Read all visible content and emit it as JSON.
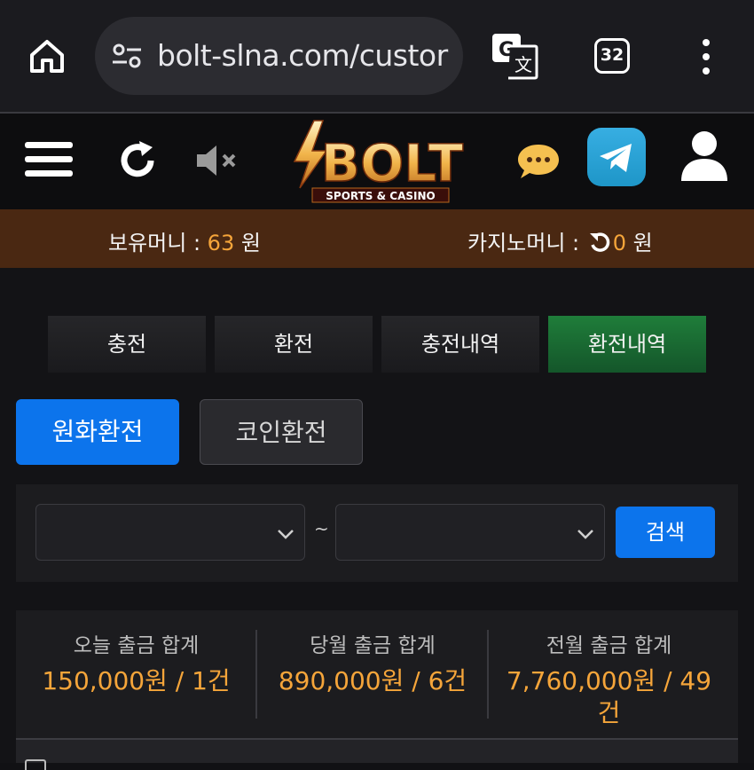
{
  "browser": {
    "url": "bolt-slna.com/custor",
    "tab_count": "32",
    "icons": [
      "home-icon",
      "site-settings-icon",
      "translate-icon",
      "tabs-icon",
      "more-icon"
    ]
  },
  "header": {
    "logo_main": "BOLT",
    "logo_sub": "SPORTS & CASINO",
    "icons": [
      "menu-icon",
      "refresh-icon",
      "mute-icon",
      "chat-icon",
      "telegram-icon",
      "user-icon"
    ]
  },
  "balance": {
    "holding_label": "보유머니 : ",
    "holding_value": "63",
    "holding_unit": " 원",
    "casino_label": "카지노머니 : ",
    "casino_value": "0",
    "casino_unit": " 원"
  },
  "tabs": [
    {
      "label": "충전",
      "active": false
    },
    {
      "label": "환전",
      "active": false
    },
    {
      "label": "충전내역",
      "active": false
    },
    {
      "label": "환전내역",
      "active": true
    }
  ],
  "subtabs": [
    {
      "label": "원화환전",
      "active": true
    },
    {
      "label": "코인환전",
      "active": false
    }
  ],
  "filter": {
    "start_value": "",
    "end_value": "",
    "separator": "~",
    "search_label": "검색"
  },
  "stats": [
    {
      "label": "오늘 출금 합계",
      "value": "150,000원 / 1건"
    },
    {
      "label": "당월 출금 합계",
      "value": "890,000원 / 6건"
    },
    {
      "label": "전월 출금 합계",
      "value": "7,760,000원 / 49",
      "value2": "건"
    }
  ],
  "colors": {
    "accent_blue": "#0c74ec",
    "active_green": "#1f7d3a",
    "balance_bar": "#4a2812",
    "amount_orange": "#f5a53a"
  }
}
